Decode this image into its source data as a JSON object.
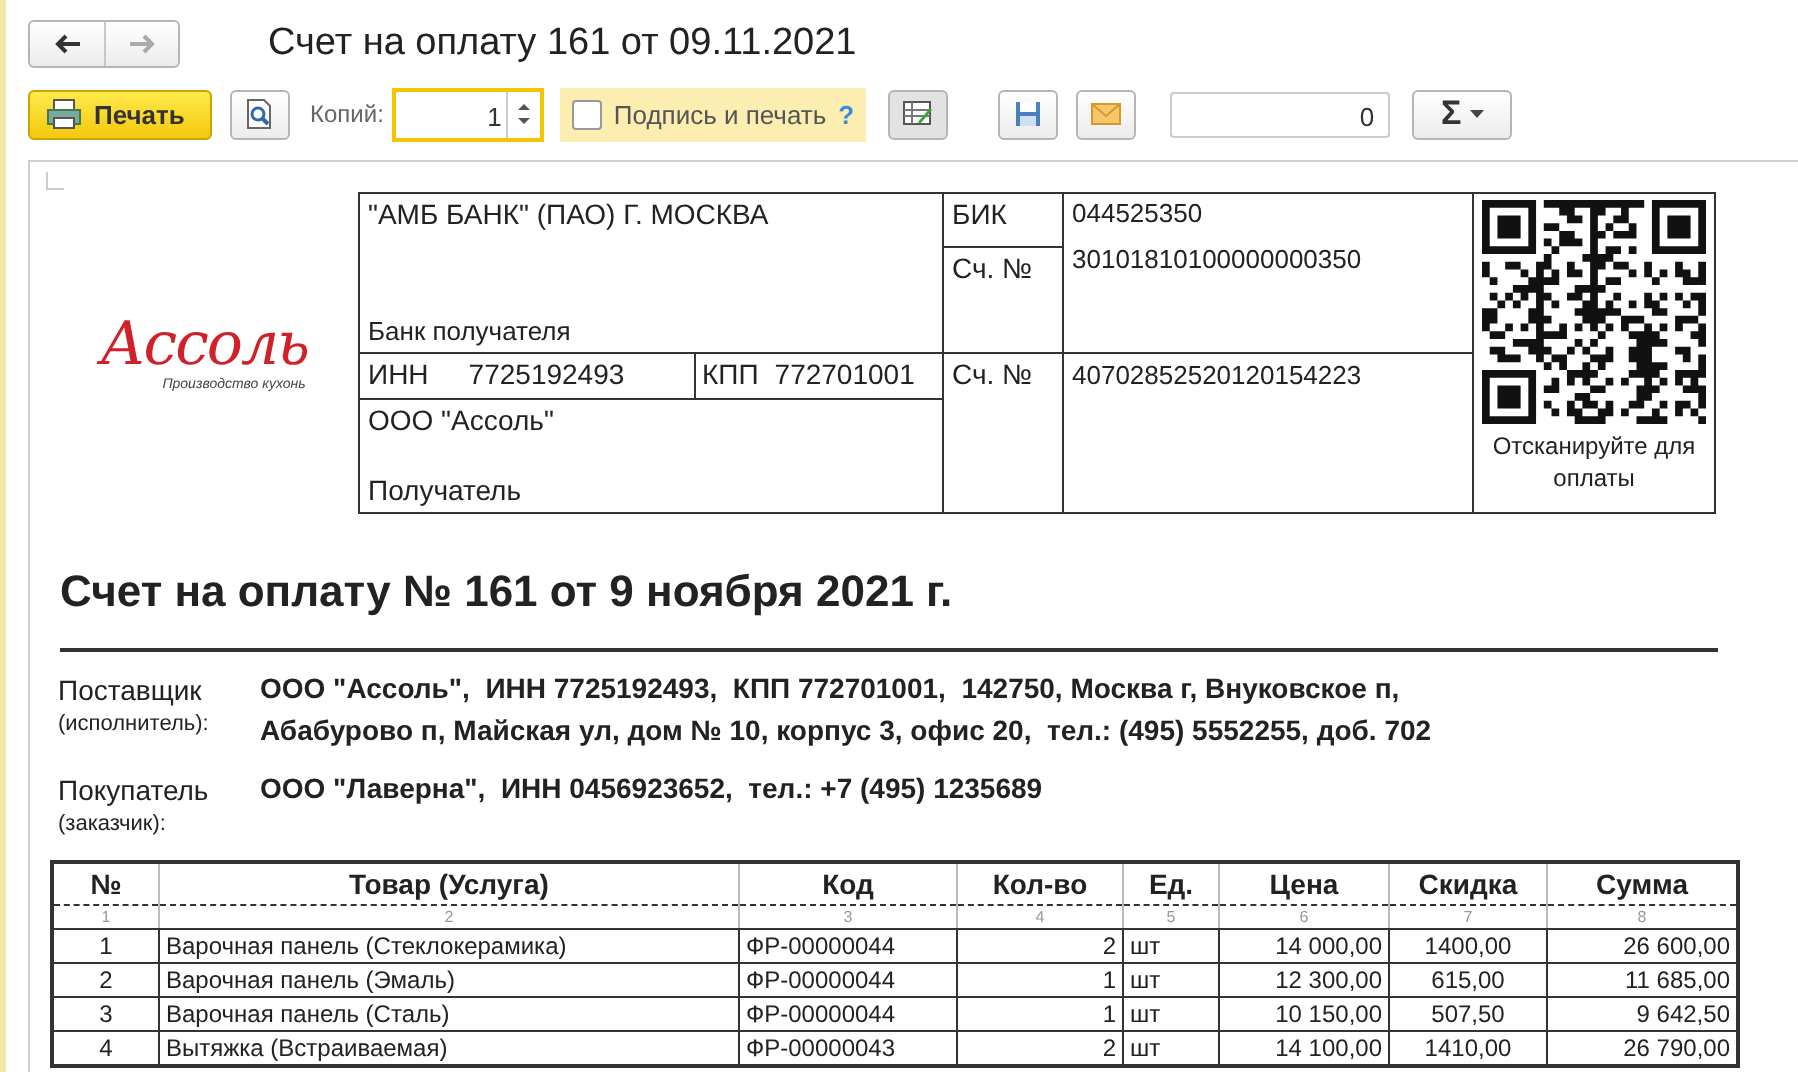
{
  "window": {
    "title": "Счет на оплату 161 от 09.11.2021"
  },
  "toolbar": {
    "print_button": "Печать",
    "copies_label": "Копий:",
    "copies_value": "1",
    "sign_and_print": {
      "label": "Подпись и печать",
      "checked": false
    },
    "help": "?",
    "number_value": "0",
    "sum_button": "Σ"
  },
  "logo": {
    "name": "Ассоль",
    "tagline": "Производство кухонь"
  },
  "bank": {
    "bank_name": "\"АМБ БАНК\" (ПАО) Г. МОСКВА",
    "bank_label": "Банк получателя",
    "bik_label": "БИК",
    "bik": "044525350",
    "corr_label": "Сч. №",
    "corr_account": "30101810100000000350",
    "inn_label": "ИНН",
    "inn": "7725192493",
    "kpp_label": "КПП",
    "kpp": "772701001",
    "account_label": "Сч. №",
    "account": "40702852520120154223",
    "recipient": "ООО \"Ассоль\"",
    "recipient_label": "Получатель",
    "qr_caption": "Отсканируйте для оплаты"
  },
  "document": {
    "title": "Счет на оплату № 161 от 9 ноября 2021 г.",
    "parties": [
      {
        "label": "Поставщик",
        "sublabel": "(исполнитель):",
        "lines": [
          "ООО \"Ассоль\",  ИНН 7725192493,  КПП 772701001,  142750, Москва г, Внуковское п,",
          "Абабурово п, Майская ул, дом № 10, корпус 3, офис 20,  тел.: (495) 5552255, доб. 702"
        ]
      },
      {
        "label": "Покупатель",
        "sublabel": "(заказчик):",
        "lines": [
          "ООО \"Лаверна\",  ИНН 0456923652,  тел.: +7 (495) 1235689"
        ]
      }
    ]
  },
  "table": {
    "columns": [
      {
        "label": "№",
        "index": "1"
      },
      {
        "label": "Товар (Услуга)",
        "index": "2"
      },
      {
        "label": "Код",
        "index": "3"
      },
      {
        "label": "Кол-во",
        "index": "4"
      },
      {
        "label": "Ед.",
        "index": "5"
      },
      {
        "label": "Цена",
        "index": "6"
      },
      {
        "label": "Скидка",
        "index": "7"
      },
      {
        "label": "Сумма",
        "index": "8"
      }
    ],
    "rows": [
      [
        "1",
        "Варочная панель (Стеклокерамика)",
        "ФР-00000044",
        "2",
        "шт",
        "14 000,00",
        "1400,00",
        "26 600,00"
      ],
      [
        "2",
        "Варочная панель (Эмаль)",
        "ФР-00000044",
        "1",
        "шт",
        "12 300,00",
        "615,00",
        "11 685,00"
      ],
      [
        "3",
        "Варочная панель (Сталь)",
        "ФР-00000044",
        "1",
        "шт",
        "10 150,00",
        "507,50",
        "9 642,50"
      ],
      [
        "4",
        "Вытяжка (Встраиваемая)",
        "ФР-00000043",
        "2",
        "шт",
        "14 100,00",
        "1410,00",
        "26 790,00"
      ]
    ]
  }
}
